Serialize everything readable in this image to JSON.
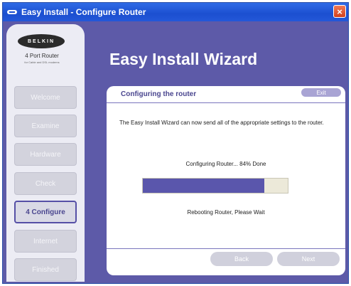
{
  "window": {
    "title": "Easy Install - Configure Router",
    "close_label": "×"
  },
  "sidebar": {
    "logo": "BELKIN",
    "product_name": "4 Port Router",
    "product_sub": "for Cable and DSL modems",
    "items": [
      {
        "label": "Welcome",
        "state": "disabled"
      },
      {
        "label": "Examine",
        "state": "disabled"
      },
      {
        "label": "Hardware",
        "state": "disabled"
      },
      {
        "label": "Check",
        "state": "disabled"
      },
      {
        "label": "4 Configure",
        "state": "active"
      },
      {
        "label": "Internet",
        "state": "disabled"
      },
      {
        "label": "Finished",
        "state": "disabled"
      }
    ]
  },
  "header": {
    "title": "Easy Install Wizard"
  },
  "panel": {
    "title": "Configuring the router",
    "exit_label": "Exit",
    "description": "The Easy Install Wizard can now send all of the appropriate settings to the router.",
    "progress_label": "Configuring Router... 84% Done",
    "progress_value": 0.84,
    "status": "Rebooting Router, Please Wait",
    "back_label": "Back",
    "next_label": "Next"
  },
  "colors": {
    "window_bg": "#5d5aa8",
    "titlebar": "#1c4fd0",
    "progress_fill": "#5a56ac",
    "active_border": "#5650a6"
  }
}
